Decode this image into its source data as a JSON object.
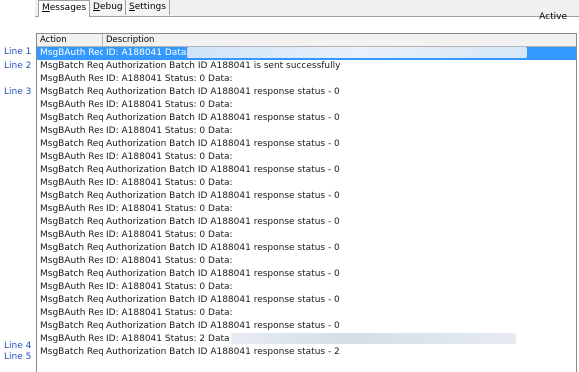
{
  "tabs": [
    {
      "pre": "",
      "acc": "M",
      "post": "essages",
      "active": true
    },
    {
      "pre": "",
      "acc": "D",
      "post": "ebug",
      "active": false
    },
    {
      "pre": "",
      "acc": "S",
      "post": "ettings",
      "active": false
    }
  ],
  "status": "Active",
  "line_labels": [
    "Line 1",
    "Line 2",
    "Line 3",
    "Line 4",
    "Line 5"
  ],
  "columns": {
    "action": "Action",
    "description": "Description"
  },
  "rows": [
    {
      "action": "MsgBAuth Req",
      "description": "ID: A188041 Data",
      "selected": true,
      "redacted": true
    },
    {
      "action": "MsgBatch Req I",
      "description": "Authorization Batch ID A188041 is sent successfully"
    },
    {
      "action": "MsgBAuth Res",
      "description": "ID: A188041 Status: 0 Data:"
    },
    {
      "action": "MsgBatch Req I",
      "description": "Authorization Batch ID A188041 response status - 0"
    },
    {
      "action": "MsgBAuth Res",
      "description": "ID: A188041 Status: 0 Data:"
    },
    {
      "action": "MsgBatch Req I",
      "description": "Authorization Batch ID A188041 response status - 0"
    },
    {
      "action": "MsgBAuth Res",
      "description": "ID: A188041 Status: 0 Data:"
    },
    {
      "action": "MsgBatch Req I",
      "description": "Authorization Batch ID A188041 response status - 0"
    },
    {
      "action": "MsgBAuth Res",
      "description": "ID: A188041 Status: 0 Data:"
    },
    {
      "action": "MsgBatch Req I",
      "description": "Authorization Batch ID A188041 response status - 0"
    },
    {
      "action": "MsgBAuth Res",
      "description": "ID: A188041 Status: 0 Data:"
    },
    {
      "action": "MsgBatch Req I",
      "description": "Authorization Batch ID A188041 response status - 0"
    },
    {
      "action": "MsgBAuth Res",
      "description": "ID: A188041 Status: 0 Data:"
    },
    {
      "action": "MsgBatch Req I",
      "description": "Authorization Batch ID A188041 response status - 0"
    },
    {
      "action": "MsgBAuth Res",
      "description": "ID: A188041 Status: 0 Data:"
    },
    {
      "action": "MsgBatch Req I",
      "description": "Authorization Batch ID A188041 response status - 0"
    },
    {
      "action": "MsgBAuth Res",
      "description": "ID: A188041 Status: 0 Data:"
    },
    {
      "action": "MsgBatch Req I",
      "description": "Authorization Batch ID A188041 response status - 0"
    },
    {
      "action": "MsgBAuth Res",
      "description": "ID: A188041 Status: 0 Data:"
    },
    {
      "action": "MsgBatch Req I",
      "description": "Authorization Batch ID A188041 response status - 0"
    },
    {
      "action": "MsgBAuth Res",
      "description": "ID: A188041 Status: 0 Data:"
    },
    {
      "action": "MsgBatch Req I",
      "description": "Authorization Batch ID A188041 response status - 0"
    },
    {
      "action": "MsgBAuth Res",
      "description": "ID: A188041 Status: 2 Data",
      "redacted": true
    },
    {
      "action": "MsgBatch Req I",
      "description": "Authorization Batch ID A188041 response status - 2"
    }
  ],
  "colors": {
    "selection": "#3399ff",
    "line_label": "#1f4fbf"
  }
}
